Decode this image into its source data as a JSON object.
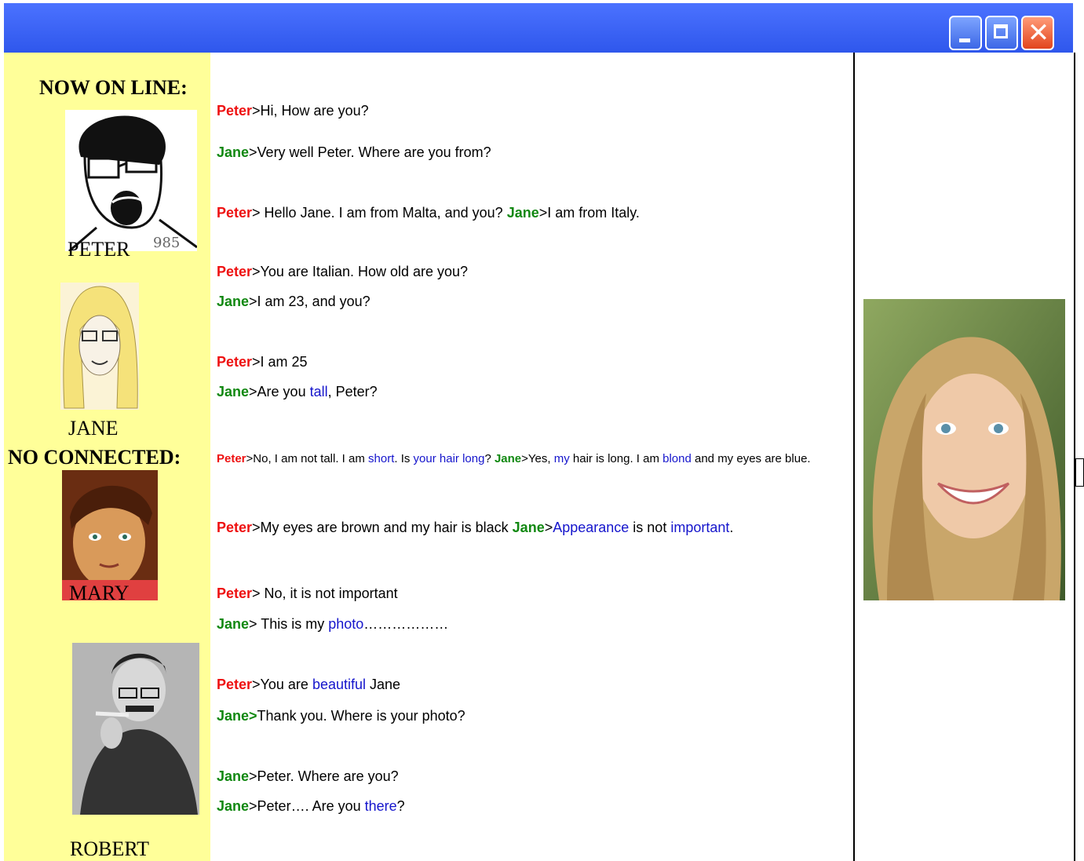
{
  "sidebar": {
    "online_heading": "NOW ON LINE:",
    "offline_heading": "NO CONNECTED:",
    "users": {
      "peter": "PETER",
      "jane": "JANE",
      "mary": "MARY",
      "robert": "ROBERT"
    }
  },
  "chat": {
    "lines": [
      [
        {
          "who": "peter",
          "t": "Peter"
        },
        {
          "t": ">Hi, How are you?"
        }
      ],
      [
        {
          "who": "jane",
          "t": "Jane"
        },
        {
          "t": ">Very well Peter. Where are you from?"
        }
      ],
      [
        {
          "who": "peter",
          "t": "Peter"
        },
        {
          "t": "> Hello Jane. I am from Malta, and you? "
        },
        {
          "who": "jane",
          "t": "Jane"
        },
        {
          "t": ">I am from Italy."
        }
      ],
      [
        {
          "who": "peter",
          "t": "Peter"
        },
        {
          "t": ">You are Italian. How old are you?"
        }
      ],
      [
        {
          "who": "jane",
          "t": "Jane"
        },
        {
          "t": ">I am 23, and you?"
        }
      ],
      [
        {
          "who": "peter",
          "t": "Peter"
        },
        {
          "t": ">I am 25"
        }
      ],
      [
        {
          "who": "jane",
          "t": "Jane"
        },
        {
          "t": ">Are you "
        },
        {
          "v": 1,
          "t": "tall"
        },
        {
          "t": ", Peter?"
        }
      ],
      [
        {
          "who": "peter",
          "t": "Peter"
        },
        {
          "t": ">No, I am not tall. I am "
        },
        {
          "v": 1,
          "t": "short"
        },
        {
          "t": ". Is "
        },
        {
          "v": 1,
          "t": "your hair long"
        },
        {
          "t": "? "
        },
        {
          "who": "jane",
          "t": "Jane"
        },
        {
          "t": ">Yes, "
        },
        {
          "v": 1,
          "t": "my"
        },
        {
          "t": " hair is long. I am "
        },
        {
          "v": 1,
          "t": "blond"
        },
        {
          "t": " and my eyes are blue."
        }
      ],
      [
        {
          "who": "peter",
          "t": "Peter"
        },
        {
          "t": ">My eyes are brown and my hair is black "
        },
        {
          "who": "jane",
          "t": "Jane"
        },
        {
          "t": ">"
        },
        {
          "v": 1,
          "t": "Appearance"
        },
        {
          "t": " is not "
        },
        {
          "v": 1,
          "t": "important"
        },
        {
          "t": "."
        }
      ],
      [
        {
          "who": "peter",
          "t": "Peter"
        },
        {
          "t": "> No, it is not important"
        }
      ],
      [
        {
          "who": "jane",
          "t": "Jane"
        },
        {
          "t": "> This is my "
        },
        {
          "v": 1,
          "t": "photo"
        },
        {
          "t": "………………"
        }
      ],
      [
        {
          "who": "peter",
          "t": "Peter"
        },
        {
          "t": ">You are "
        },
        {
          "v": 1,
          "t": "beautiful"
        },
        {
          "t": " Jane"
        }
      ],
      [
        {
          "who": "jane",
          "t": "Jane>"
        },
        {
          "t": "Thank you. Where is your photo?"
        }
      ],
      [
        {
          "who": "jane",
          "t": "Jane"
        },
        {
          "t": ">Peter. Where are you?"
        }
      ],
      [
        {
          "who": "jane",
          "t": "Jane"
        },
        {
          "t": ">Peter…. Are you "
        },
        {
          "v": 1,
          "t": "there"
        },
        {
          "t": "?"
        }
      ]
    ]
  },
  "colors": {
    "titlebar": "#3a60f0",
    "sidebar": "#ffff99",
    "peter": "#ee1111",
    "jane": "#118811",
    "vocab": "#1515cc"
  },
  "icons": {
    "minimize": "minimize-icon",
    "maximize": "maximize-icon",
    "close": "close-icon"
  }
}
